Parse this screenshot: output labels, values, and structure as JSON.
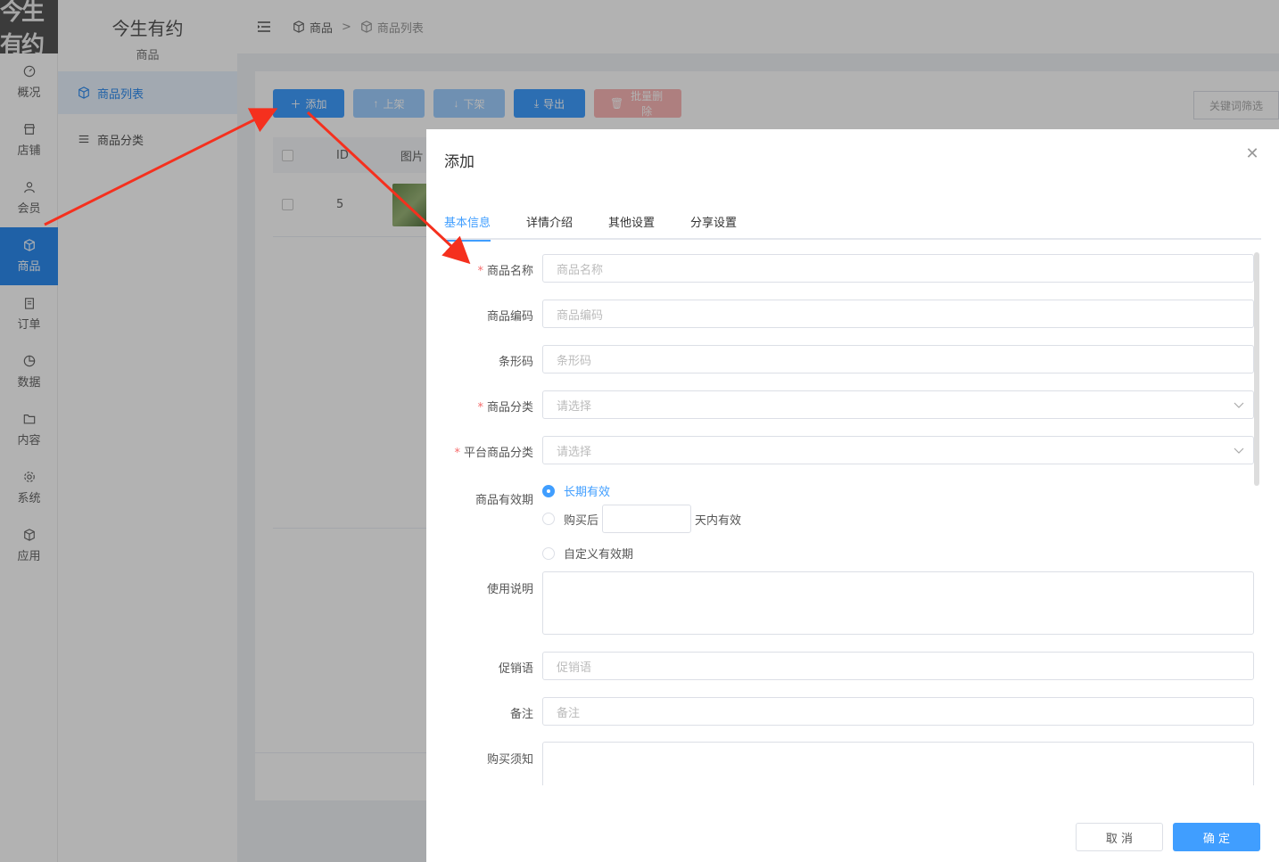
{
  "logo_text": "今生有约",
  "nav": [
    {
      "label": "概况",
      "icon": "dashboard-icon"
    },
    {
      "label": "店铺",
      "icon": "store-icon"
    },
    {
      "label": "会员",
      "icon": "user-icon"
    },
    {
      "label": "商品",
      "icon": "package-icon",
      "active": true
    },
    {
      "label": "订单",
      "icon": "clipboard-icon"
    },
    {
      "label": "数据",
      "icon": "pie-chart-icon"
    },
    {
      "label": "内容",
      "icon": "folder-icon"
    },
    {
      "label": "系统",
      "icon": "gear-icon"
    },
    {
      "label": "应用",
      "icon": "cube-icon"
    }
  ],
  "subnav": {
    "title": "今生有约",
    "subtitle": "商品",
    "items": [
      {
        "label": "商品列表",
        "active": true
      },
      {
        "label": "商品分类",
        "active": false
      }
    ]
  },
  "breadcrumb": [
    "商品",
    "商品列表"
  ],
  "breadcrumb_sep": ">",
  "toolbar": {
    "add": "添加",
    "on_shelf": "上架",
    "off_shelf": "下架",
    "export": "导出",
    "batch_delete": "批量删除",
    "filter": "关键词筛选"
  },
  "table": {
    "headers": [
      "ID",
      "图片"
    ],
    "rows": [
      {
        "id": "5"
      }
    ]
  },
  "drawer": {
    "title": "添加",
    "tabs": [
      "基本信息",
      "详情介绍",
      "其他设置",
      "分享设置"
    ],
    "active_tab": 0,
    "fields": {
      "name": {
        "label": "商品名称",
        "placeholder": "商品名称",
        "required": true
      },
      "code": {
        "label": "商品编码",
        "placeholder": "商品编码"
      },
      "barcode": {
        "label": "条形码",
        "placeholder": "条形码"
      },
      "category": {
        "label": "商品分类",
        "placeholder": "请选择",
        "required": true
      },
      "platform_category": {
        "label": "平台商品分类",
        "placeholder": "请选择",
        "required": true
      },
      "validity": {
        "label": "商品有效期",
        "options": [
          "长期有效",
          "购买后",
          "自定义有效期"
        ],
        "selected": 0,
        "days_suffix": "天内有效"
      },
      "usage": {
        "label": "使用说明"
      },
      "promo": {
        "label": "促销语",
        "placeholder": "促销语"
      },
      "remark": {
        "label": "备注",
        "placeholder": "备注"
      },
      "notice": {
        "label": "购买须知"
      }
    },
    "cancel": "取 消",
    "confirm": "确 定"
  },
  "colors": {
    "primary": "#409eff",
    "nav_active": "#2d8cf0",
    "danger": "#f56c6c",
    "arrow": "#f5301e"
  }
}
